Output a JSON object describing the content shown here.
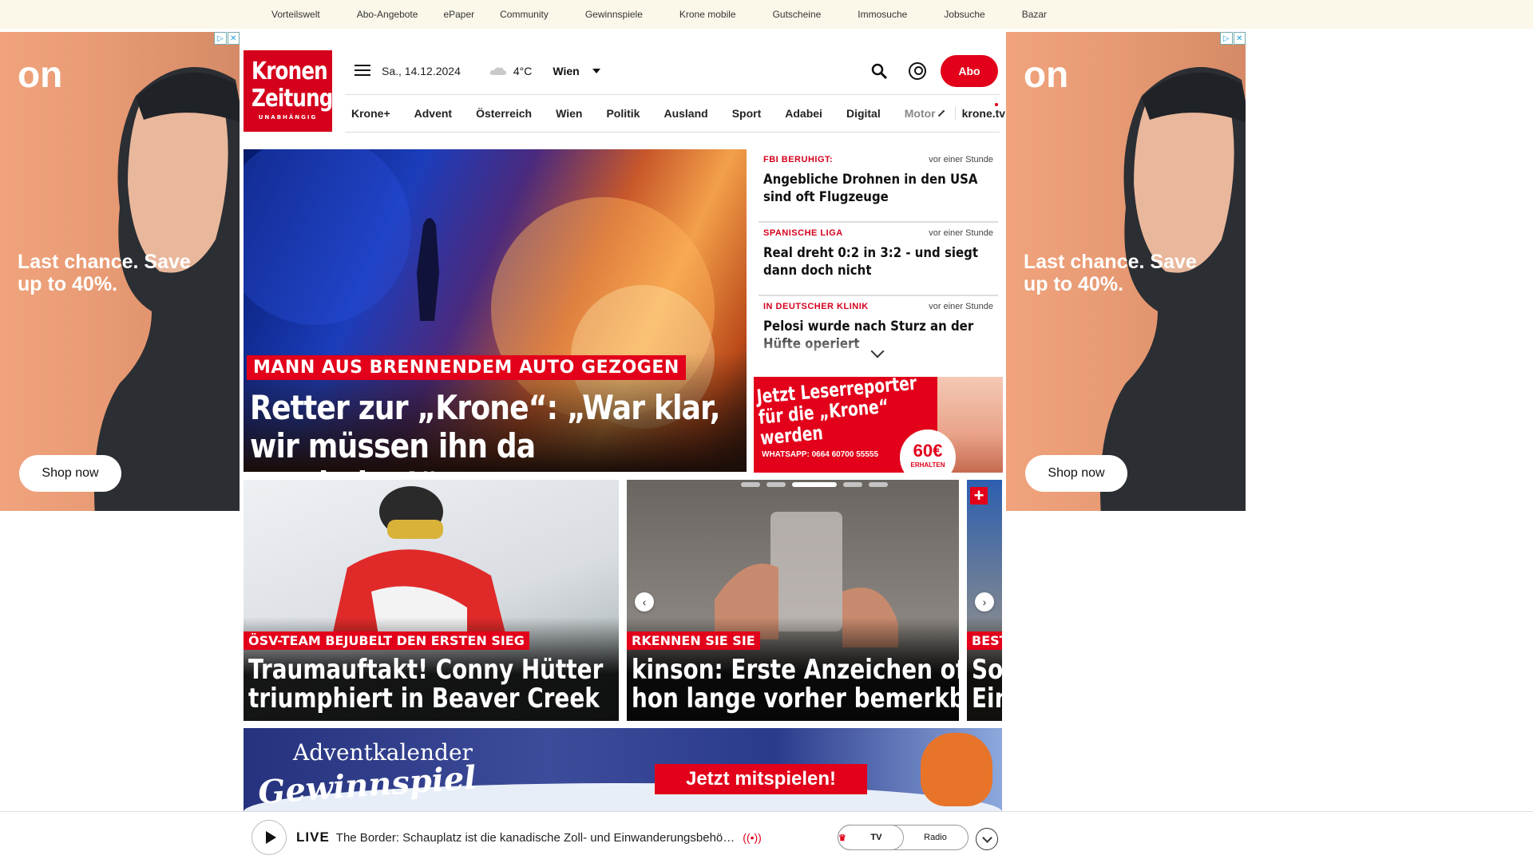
{
  "topnav": [
    "Vorteilswelt",
    "Abo-Angebote",
    "ePaper",
    "Community",
    "Gewinnspiele",
    "Krone mobile",
    "Gutscheine",
    "Immosuche",
    "Jobsuche",
    "Bazar"
  ],
  "ad": {
    "brand": "on",
    "message": "Last chance. Save up to 40%.",
    "cta": "Shop now",
    "flags": [
      "▷",
      "✕"
    ]
  },
  "logo": {
    "line1": "Kronen",
    "line2": "Zeitung",
    "tagline": "UNABHÄNGIG"
  },
  "header": {
    "date": "Sa., 14.12.2024",
    "temp": "4°C",
    "city": "Wien",
    "abo": "Abo"
  },
  "nav": {
    "items": [
      "Krone+",
      "Advent",
      "Österreich",
      "Wien",
      "Politik",
      "Ausland",
      "Sport",
      "Adabei",
      "Digital"
    ],
    "partial": "Motor",
    "tv": "krone.tv"
  },
  "hero": {
    "tag": "MANN AUS BRENNENDEM AUTO GEZOGEN",
    "title": "Retter zur „Krone“: „War klar, wir müssen ihn da rausholen!“"
  },
  "news": [
    {
      "kicker": "FBI BERUHIGT:",
      "time": "vor einer Stunde",
      "headline": "Angebliche Drohnen in den USA sind oft Flugzeuge"
    },
    {
      "kicker": "SPANISCHE LIGA",
      "time": "vor einer Stunde",
      "headline": "Real dreht 0:2 in 3:2 - und siegt dann doch nicht"
    },
    {
      "kicker": "IN DEUTSCHER KLINIK",
      "time": "vor einer Stunde",
      "headline": "Pelosi wurde nach Sturz an der Hüfte operiert"
    }
  ],
  "reporter": {
    "title": "Jetzt Leserreporter für die „Krone“ werden",
    "whatsapp": "WHATSAPP: 0664 60700 55555",
    "amount": "60€",
    "amount_sub": "ERHALTEN"
  },
  "cards": [
    {
      "tag": "ÖSV-TEAM BEJUBELT DEN ERSTEN SIEG",
      "title1": "Traumauftakt! Conny Hütter",
      "title2": "triumphiert in Beaver Creek"
    },
    {
      "tag": "RKENNEN SIE SIE",
      "title1": "kinson: Erste Anzeichen oft",
      "title2": "hon lange vorher bemerkbar"
    },
    {
      "tag": "BEST",
      "title1": "So",
      "title2": "Ein"
    }
  ],
  "advent": {
    "line1": "Adventkalender",
    "line2": "Gewinnspiel",
    "cta": "Jetzt mitspielen!"
  },
  "live": {
    "label": "LIVE",
    "text": "The Border: Schauplatz ist die kanadische Zoll- und Einwanderungsbehö…",
    "tv": "TV",
    "radio": "Radio"
  },
  "colors": {
    "accent": "#e2001a",
    "topbar": "#fbf8ea"
  }
}
